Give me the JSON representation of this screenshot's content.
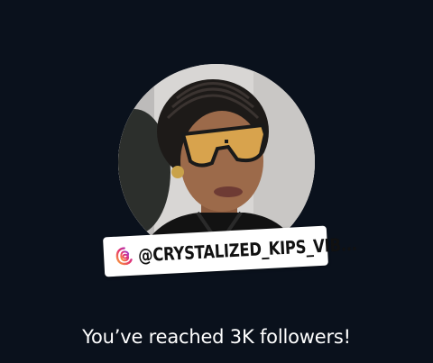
{
  "profile": {
    "username": "@CRYSTALIZED_KIPS_VIB...",
    "username_icon": "threads-icon"
  },
  "milestone": {
    "message": "You’ve reached 3K followers!"
  },
  "colors": {
    "background": "#0a111c",
    "sticker": "#ffffff",
    "text": "#ffffff"
  }
}
